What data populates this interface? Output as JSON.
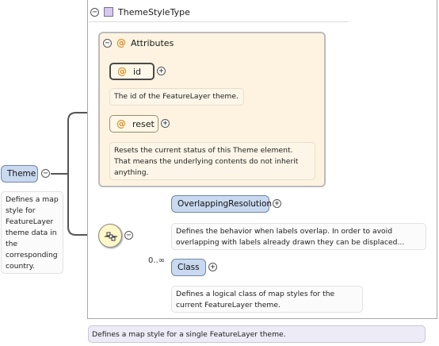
{
  "type": {
    "title": "ThemeStyleType",
    "description": "Defines a map style for a single FeatureLayer theme."
  },
  "attributes_group": {
    "label": "Attributes",
    "collapse_glyph": "−"
  },
  "attributes": [
    {
      "name": "id",
      "expand_glyph": "+",
      "description": "The id of the FeatureLayer theme."
    },
    {
      "name": "reset",
      "expand_glyph": "+",
      "description": "Resets the current status of this Theme element. That means the underlying contents do not inherit anything."
    }
  ],
  "root_element": {
    "name": "Theme",
    "collapse_glyph": "−",
    "description": "Defines a map style for FeatureLayer theme data in the corresponding country."
  },
  "sequence": {
    "collapse_glyph": "−"
  },
  "children": [
    {
      "name": "OverlappingResolution",
      "expand_glyph": "+",
      "occurrence": "",
      "description": "Defines the behavior when labels overlap. In order to avoid overlapping with labels already drawn they can be displaced..."
    },
    {
      "name": "Class",
      "expand_glyph": "+",
      "occurrence": "0..∞",
      "description": "Defines a logical class of map styles for the current FeatureLayer theme."
    }
  ],
  "type_collapse_glyph": "−",
  "attr_icon": "@",
  "colors": {
    "element": "#c9d9ef",
    "attribute_group": "#fdf3e0",
    "sequence": "#fff8c8",
    "type_note": "#ecebf6"
  },
  "icons": [
    "type-icon",
    "attribute-icon",
    "sequence-icon"
  ]
}
